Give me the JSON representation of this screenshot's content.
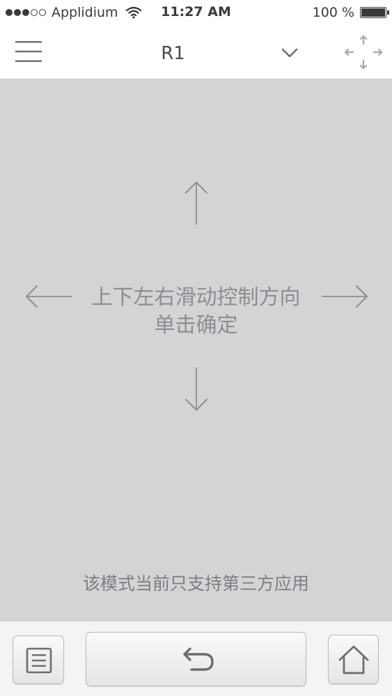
{
  "status_bar": {
    "carrier": "Applidium",
    "time": "11:27 AM",
    "battery": "100 %",
    "icons": {
      "signal": "signal-dots-icon",
      "wifi": "wifi-icon",
      "battery": "battery-icon"
    }
  },
  "nav": {
    "title": "R1",
    "icons": {
      "menu": "hamburger-menu-icon",
      "dropdown": "chevron-down-icon",
      "move": "four-way-arrows-icon"
    }
  },
  "gesture_area": {
    "hint_line1": "上下左右滑动控制方向",
    "hint_line2": "单击确定",
    "footer_note": "该模式当前只支持第三方应用",
    "icons": {
      "up": "arrow-up-icon",
      "down": "arrow-down-icon",
      "left": "arrow-left-icon",
      "right": "arrow-right-icon"
    }
  },
  "toolbar": {
    "icons": {
      "list": "list-icon",
      "back": "back-arrow-icon",
      "home": "home-icon"
    }
  },
  "colors": {
    "gesture_bg": "#d4d3d6",
    "hint_text": "#8e8d91",
    "toolbar_bg": "#f4f4f5",
    "icon_gray": "#6d6d70"
  }
}
